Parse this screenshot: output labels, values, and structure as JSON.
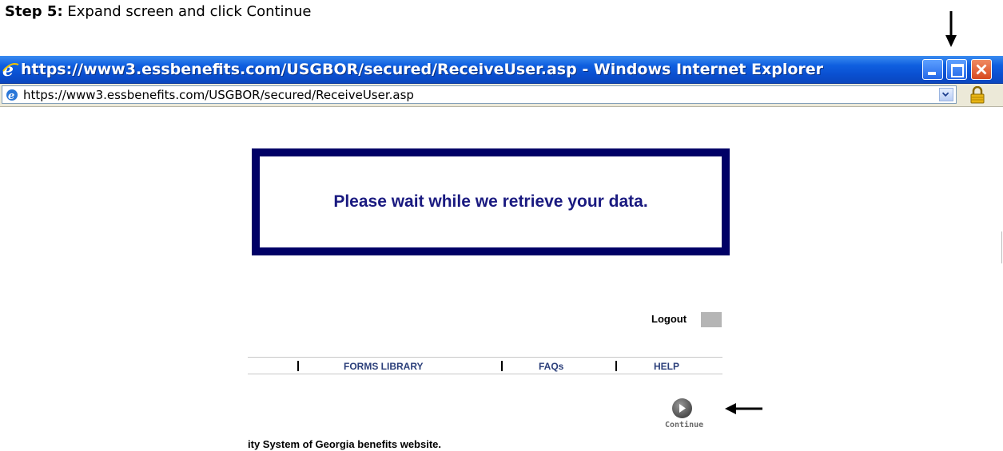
{
  "caption": {
    "step_label": "Step 5:",
    "instruction": "Expand screen and click Continue"
  },
  "window": {
    "title": "https://www3.essbenefits.com/USGBOR/secured/ReceiveUser.asp - Windows Internet Explorer",
    "app_icon": "ie-icon",
    "controls": [
      "minimize-icon",
      "maximize-icon",
      "close-icon"
    ]
  },
  "address_bar": {
    "url": "https://www3.essbenefits.com/USGBOR/secured/ReceiveUser.asp",
    "icons": [
      "ie-page-icon",
      "chevron-down-icon",
      "lock-icon"
    ]
  },
  "page": {
    "wait_message": "Please wait while we retrieve your data.",
    "logout_label": "Logout",
    "nav": {
      "separator": "|",
      "items": [
        "FORMS LIBRARY",
        "FAQs",
        "HELP"
      ]
    },
    "continue_label": "Continue",
    "footer_text": "ity System of Georgia benefits website."
  },
  "annotations": [
    "arrow-down-icon",
    "arrow-left-icon"
  ],
  "colors": {
    "titlebar": "#0a4fd0",
    "wait_border": "#000066",
    "wait_text": "#1a1a80",
    "nav_text": "#2b3f7a"
  }
}
